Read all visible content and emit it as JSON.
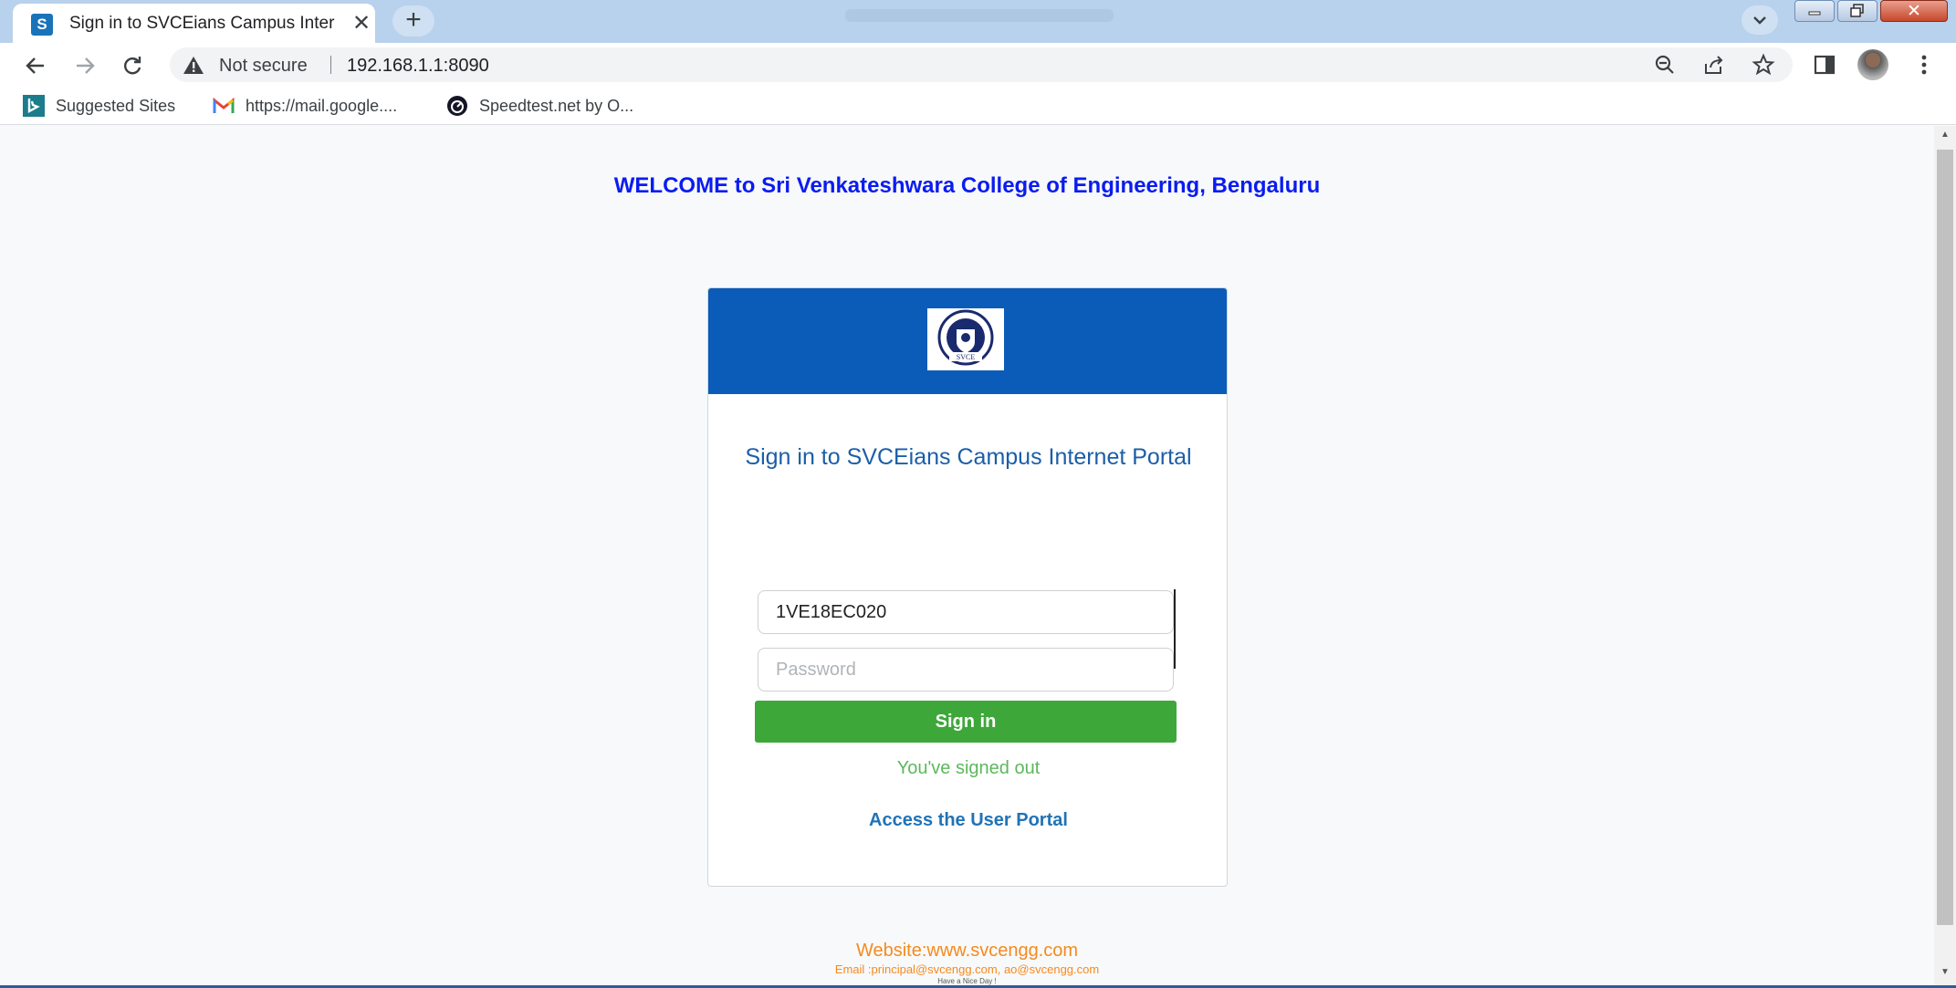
{
  "browser": {
    "tab": {
      "favicon_letter": "S",
      "title": "Sign in to SVCEians Campus Inter",
      "close_glyph": "✕"
    },
    "new_tab_glyph": "+",
    "address": {
      "security_label": "Not secure",
      "url": "192.168.1.1:8090"
    },
    "bookmarks": [
      {
        "label": "Suggested Sites",
        "icon": "bing-icon"
      },
      {
        "label": "https://mail.google....",
        "icon": "gmail-icon"
      },
      {
        "label": "Speedtest.net by O...",
        "icon": "speedtest-icon"
      }
    ],
    "window_close_glyph": "✕"
  },
  "page": {
    "welcome": "WELCOME to Sri Venkateshwara College of Engineering, Bengaluru",
    "logo_text": "SVCE",
    "signin": {
      "title": "Sign in to SVCEians Campus Internet Portal",
      "username_value": "1VE18EC020",
      "password_placeholder": "Password",
      "button_label": "Sign in",
      "status_message": "You've signed out",
      "portal_link": "Access the User Portal"
    },
    "footer": {
      "website": "Website:www.svcengg.com",
      "email": "Email :principal@svcengg.com, ao@svcengg.com",
      "greeting": "Have a Nice Day !"
    }
  },
  "colors": {
    "header_blue": "#0a5cb8",
    "welcome_blue": "#0a1cf0",
    "signin_green": "#3ea73a",
    "footer_orange": "#f58a1f"
  }
}
